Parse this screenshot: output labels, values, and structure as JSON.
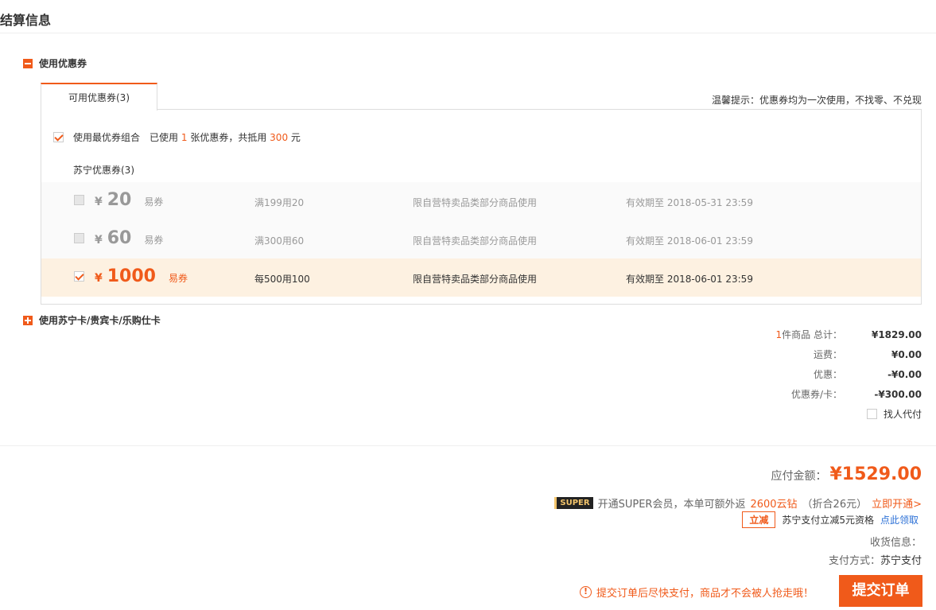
{
  "page_title": "结算信息",
  "coupon_section": {
    "title": "使用优惠券",
    "tab_label": "可用优惠券(3)",
    "tip": "温馨提示：优惠券均为一次使用，不找零、不兑现",
    "best_combo": {
      "label": "使用最优券组合",
      "used_prefix": "已使用",
      "used_count": "1",
      "used_mid": "张优惠券，共抵用",
      "saved_amount": "300",
      "saved_unit": "元"
    },
    "group_label": "苏宁优惠券(3)",
    "coupons": [
      {
        "currency": "¥",
        "value": "20",
        "type": "易券",
        "rule": "满199用20",
        "scope": "限自营特卖品类部分商品使用",
        "expire": "有效期至 2018-05-31 23:59",
        "state": "disabled"
      },
      {
        "currency": "¥",
        "value": "60",
        "type": "易券",
        "rule": "满300用60",
        "scope": "限自营特卖品类部分商品使用",
        "expire": "有效期至 2018-06-01 23:59",
        "state": "disabled"
      },
      {
        "currency": "¥",
        "value": "1000",
        "type": "易券",
        "rule": "每500用100",
        "scope": "限自营特卖品类部分商品使用",
        "expire": "有效期至 2018-06-01 23:59",
        "state": "selected"
      }
    ]
  },
  "card_section": {
    "title": "使用苏宁卡/贵宾卡/乐购仕卡"
  },
  "summary": {
    "item_count": "1",
    "items_label": "件商品 总计：",
    "items_total": "¥1829.00",
    "shipping_label": "运费：",
    "shipping": "¥0.00",
    "discount_label": "优惠：",
    "discount": "-¥0.00",
    "coupon_label": "优惠券/卡：",
    "coupon": "-¥300.00",
    "proxy_pay_label": "找人代付"
  },
  "payment": {
    "total_label": "应付金额：",
    "total": "¥1529.00",
    "super_badge": "SUPER",
    "super_text": "开通SUPER会员，本单可额外返",
    "super_reward": "2600云钻",
    "super_equiv": "（折合26元）",
    "super_link": "立即开通>",
    "lijian_badge": "立减",
    "lijian_text": "苏宁支付立减5元资格",
    "lijian_link": "点此领取",
    "receive_info": "收货信息：",
    "pay_method_label": "支付方式：",
    "pay_method": "苏宁支付",
    "warning": "提交订单后尽快支付，商品才不会被人抢走哦！",
    "submit_label": "提交订单"
  },
  "colors": {
    "accent": "#f05a1a",
    "selected_row_bg": "#fdf1e1",
    "link_blue": "#2a6fd6"
  }
}
